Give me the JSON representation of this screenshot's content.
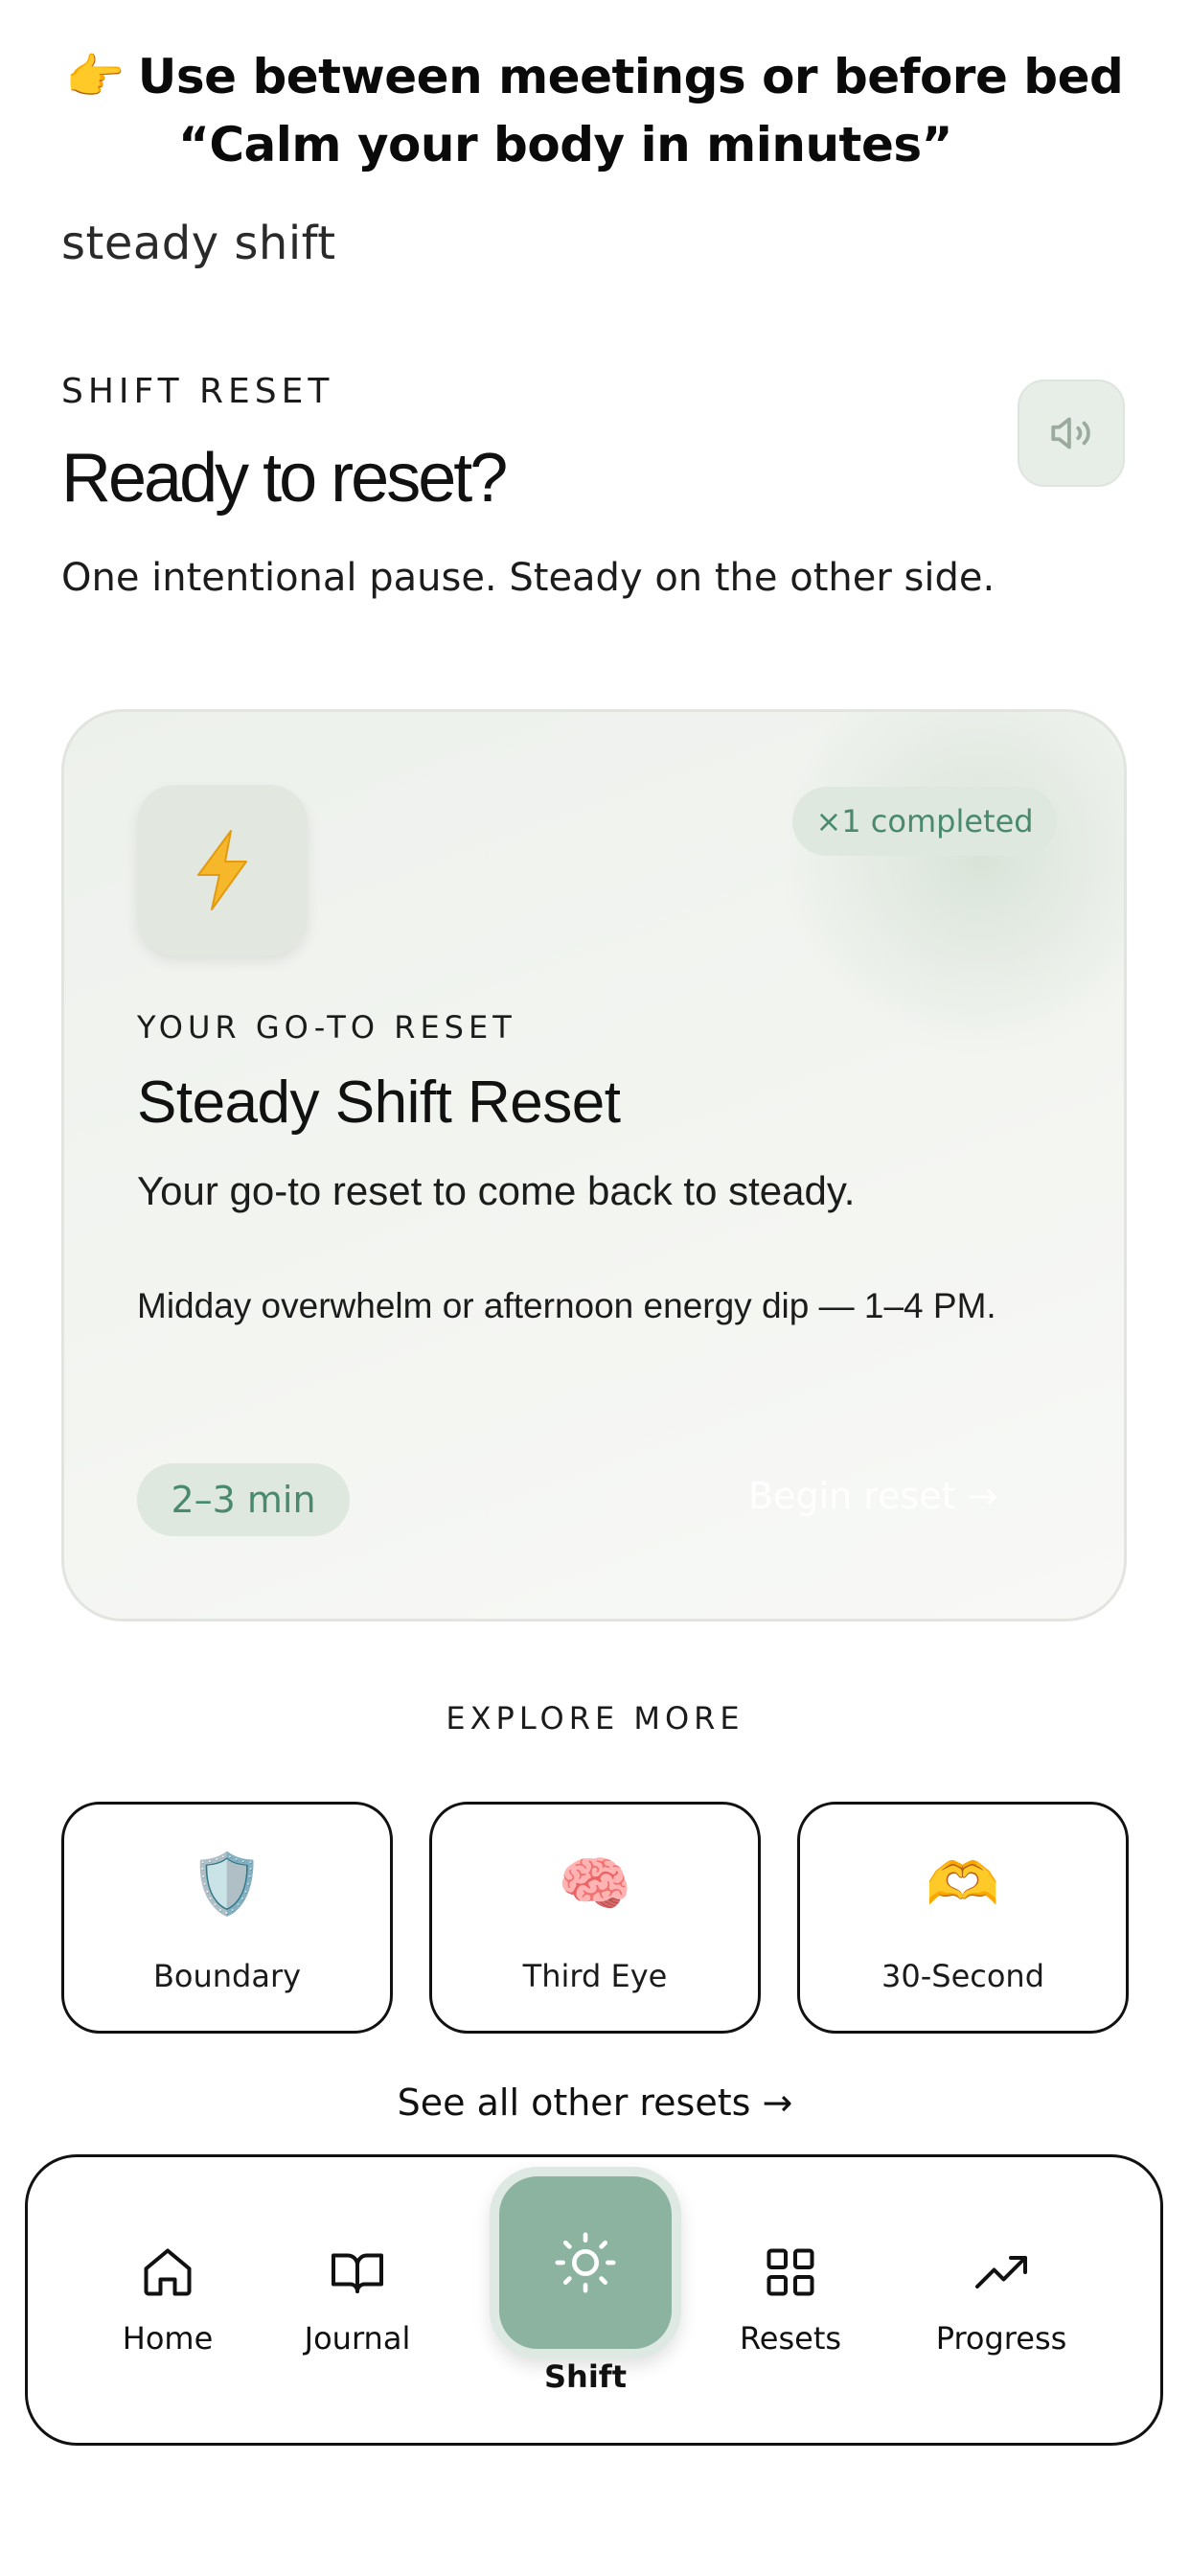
{
  "banner": {
    "emoji": "👉",
    "line1": "Use between meetings or before bed",
    "line2": "“Calm your body in minutes”"
  },
  "brand": "steady shift",
  "header": {
    "eyebrow": "SHIFT RESET",
    "title": "Ready to reset?",
    "subtitle": "One intentional pause. Steady on the other side.",
    "sound_icon": "speaker-icon"
  },
  "card": {
    "icon": "⚡",
    "completed_badge": "×1 completed",
    "eyebrow": "YOUR GO-TO RESET",
    "title": "Steady Shift Reset",
    "subtitle": "Your go-to reset to come back to steady.",
    "description": "Midday overwhelm or afternoon energy dip — 1–4 PM.",
    "duration": "2–3 min",
    "cta": "Begin reset →"
  },
  "explore": {
    "title": "EXPLORE MORE",
    "items": [
      {
        "emoji": "🛡️",
        "label": "Boundary"
      },
      {
        "emoji": "🧠",
        "label": "Third Eye"
      },
      {
        "emoji": "🫶",
        "label": "30-Second"
      }
    ],
    "see_all": "See all other resets →"
  },
  "tabbar": {
    "items": [
      {
        "label": "Home",
        "icon": "home-icon"
      },
      {
        "label": "Journal",
        "icon": "book-icon"
      },
      {
        "label": "Shift",
        "icon": "sun-icon"
      },
      {
        "label": "Resets",
        "icon": "grid-icon"
      },
      {
        "label": "Progress",
        "icon": "trending-up-icon"
      }
    ]
  },
  "colors": {
    "accent": "#8bb3a0",
    "accent_text": "#4a8a6c",
    "pill_bg": "#dfe8df",
    "card_bg": "#f0f3ef"
  }
}
